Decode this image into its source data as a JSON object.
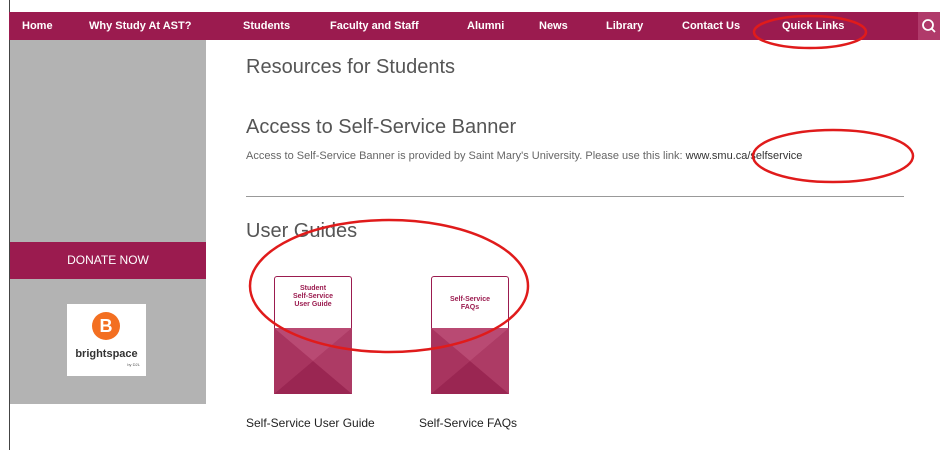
{
  "nav": {
    "items": [
      "Home",
      "Why Study At AST?",
      "Students",
      "Faculty and Staff",
      "Alumni",
      "News",
      "Library",
      "Contact Us",
      "Quick Links"
    ]
  },
  "sidebar": {
    "donate_label": "DONATE NOW",
    "brightspace_logo_letter": "B",
    "brightspace_label": "brightspace",
    "brightspace_sub": "by D2L"
  },
  "main": {
    "resources_heading": "Resources for Students",
    "access_heading": "Access to Self-Service Banner",
    "access_text": "Access to Self-Service Banner is provided by Saint Mary's University. Please use this link: ",
    "access_link": "www.smu.ca/selfservice",
    "guides_heading": "User Guides",
    "guides": [
      {
        "card_title_lines": [
          "Student",
          "Self-Service",
          "User Guide"
        ],
        "label": "Self-Service User Guide"
      },
      {
        "card_title_lines": [
          "Self-Service",
          "FAQs"
        ],
        "label": "Self-Service FAQs"
      }
    ]
  },
  "colors": {
    "brand": "#9b1b4f",
    "sidebar": "#b3b3b3",
    "annotation": "#e01b1b",
    "brightspace_orange": "#f36f21"
  },
  "icons": [
    "search-icon"
  ]
}
